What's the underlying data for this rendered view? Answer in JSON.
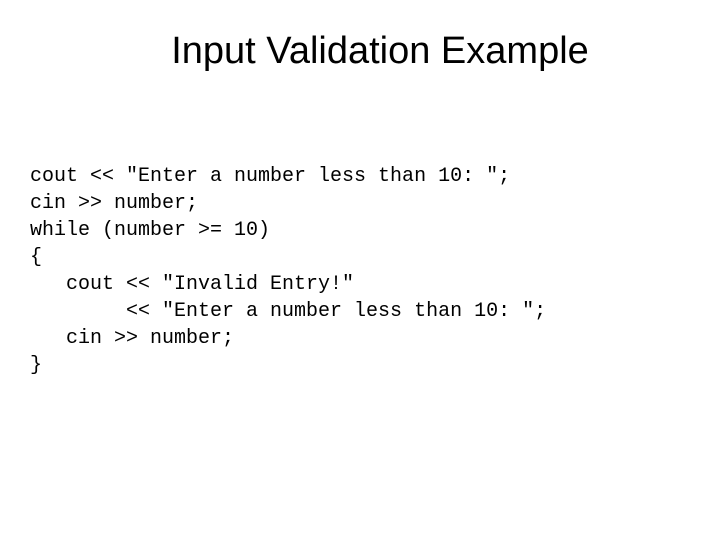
{
  "slide": {
    "title": "Input Validation Example",
    "code": {
      "line1": "cout << \"Enter a number less than 10: \";",
      "line2": "cin >> number;",
      "line3": "while (number >= 10)",
      "line4": "{",
      "line5": "   cout << \"Invalid Entry!\"",
      "line6": "        << \"Enter a number less than 10: \";",
      "line7": "   cin >> number;",
      "line8": "}"
    }
  }
}
